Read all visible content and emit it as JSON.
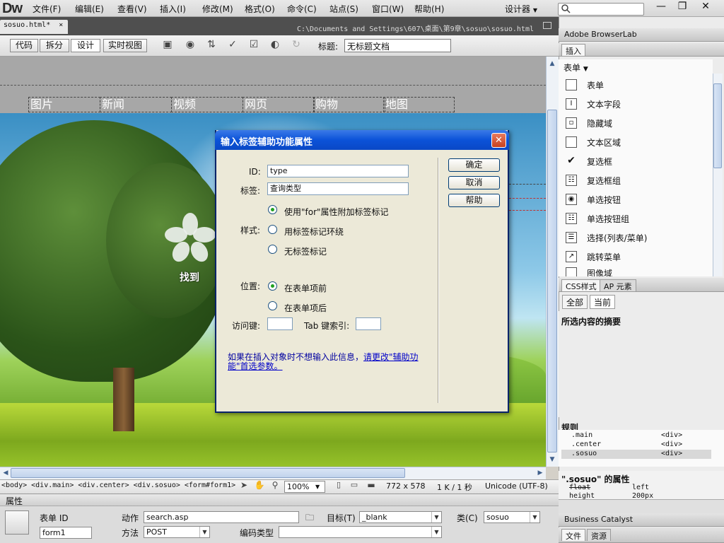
{
  "app": {
    "logo": "Dw",
    "menus": [
      "文件(F)",
      "编辑(E)",
      "查看(V)",
      "插入(I)",
      "修改(M)",
      "格式(O)",
      "命令(C)",
      "站点(S)",
      "窗口(W)",
      "帮助(H)"
    ],
    "workspace": "设计器",
    "window_controls": [
      "—",
      "❐",
      "✕"
    ]
  },
  "document": {
    "tab": "sosuo.html*",
    "tab_close": "×",
    "path": "C:\\Documents and Settings\\607\\桌面\\第9章\\sosuo\\sosuo.html"
  },
  "toolbar": {
    "views": [
      "代码",
      "拆分",
      "设计",
      "实时视图"
    ],
    "title_label": "标题:",
    "title_value": "无标题文档"
  },
  "canvas": {
    "nav": [
      "图片",
      "新闻",
      "视频",
      "网页",
      "购物",
      "地图"
    ],
    "find_label": "找到"
  },
  "dialog": {
    "title": "输入标签辅助功能属性",
    "close": "✕",
    "id_label": "ID:",
    "id_value": "type",
    "tag_label": "标签:",
    "tag_value": "查询类型",
    "style_label": "样式:",
    "style_options": [
      "使用\"for\"属性附加标签标记",
      "用标签标记环绕",
      "无标签标记"
    ],
    "style_selected": 0,
    "position_label": "位置:",
    "position_options": [
      "在表单项前",
      "在表单项后"
    ],
    "position_selected": 0,
    "access_key_label": "访问键:",
    "tab_index_label": "Tab 键索引:",
    "note_text": "如果在插入对象时不想输入此信息，",
    "note_link": "请更改\"辅助功能\"首选参数。",
    "ok": "确定",
    "cancel": "取消",
    "help": "帮助"
  },
  "status": {
    "tag_selector": "<body> <div.main> <div.center> <div.sosuo> <form#form1>",
    "zoom": "100%",
    "size": "772 x 578",
    "filesize": "1 K / 1 秒",
    "encoding": "Unicode (UTF-8)"
  },
  "properties": {
    "panel_title": "属性",
    "form_id_label": "表单 ID",
    "form_id": "form1",
    "action_label": "动作",
    "action": "search.asp",
    "method_label": "方法",
    "method": "POST",
    "target_label": "目标(T)",
    "target": "_blank",
    "enctype_label": "编码类型",
    "enctype": "",
    "class_label": "类(C)",
    "class": "sosuo"
  },
  "right_panels": {
    "browserlab": "Adobe BrowserLab",
    "insert_tab": "插入",
    "insert_category": "表单",
    "insert_items": [
      "表单",
      "文本字段",
      "隐藏域",
      "文本区域",
      "复选框",
      "复选框组",
      "单选按钮",
      "单选按钮组",
      "选择(列表/菜单)",
      "跳转菜单",
      "图像域"
    ],
    "css_tab": "CSS样式",
    "ap_tab": "AP 元素",
    "css_all": "全部",
    "css_current": "当前",
    "summary_title": "所选内容的摘要",
    "rules_title": "规则",
    "rules": [
      {
        "sel": ".main",
        "tag": "<div>"
      },
      {
        "sel": ".center",
        "tag": "<div>"
      },
      {
        "sel": ".sosuo",
        "tag": "<div>"
      }
    ],
    "props_title": "\".sosuo\" 的属性",
    "props": [
      {
        "name": "float",
        "value": "left"
      },
      {
        "name": "height",
        "value": "200px"
      }
    ],
    "business_catalyst": "Business Catalyst",
    "files_tab": "文件",
    "assets_tab": "资源"
  }
}
